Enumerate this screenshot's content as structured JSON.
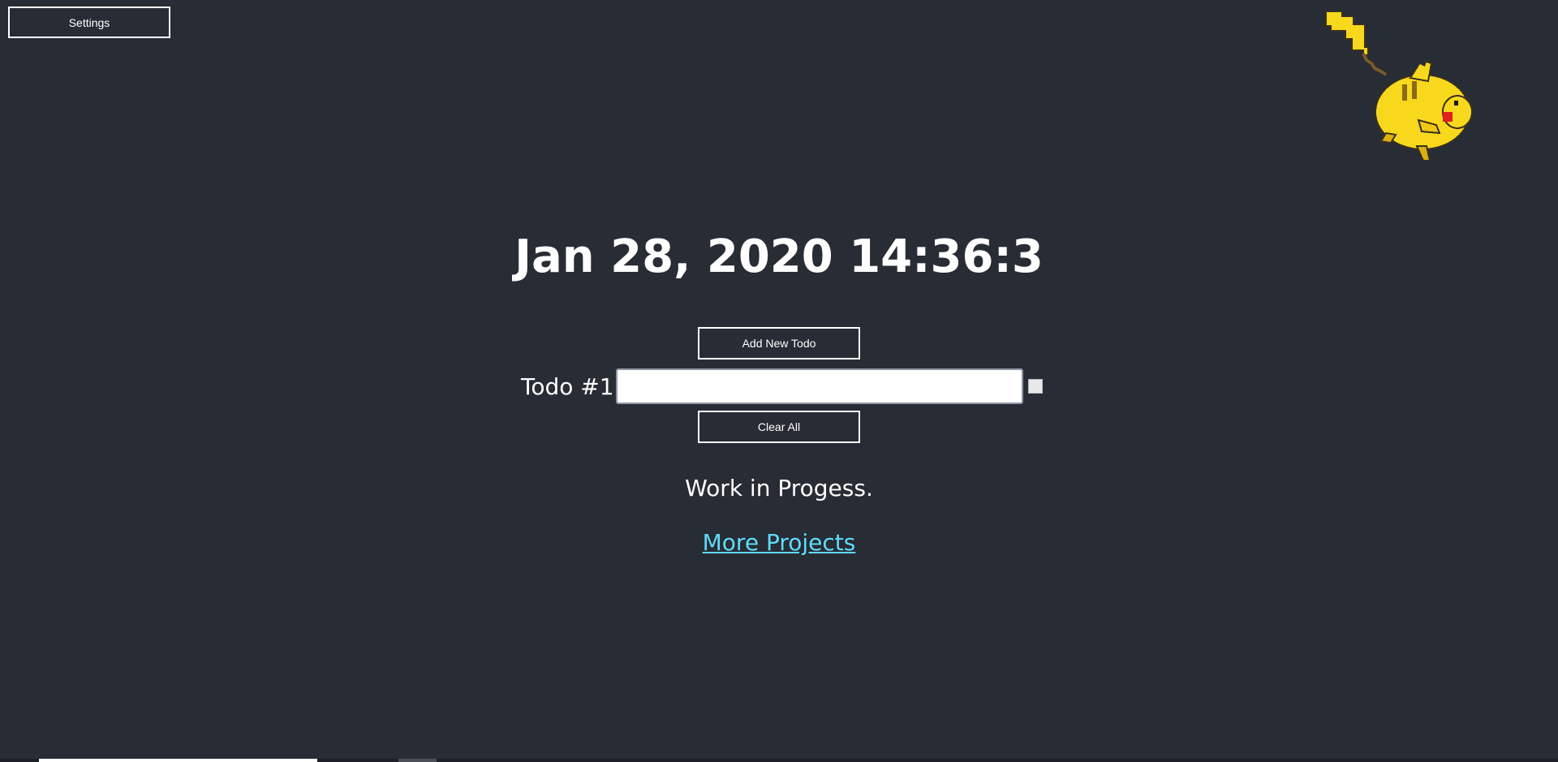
{
  "header": {
    "settings_label": "Settings"
  },
  "mascot": {
    "icon": "pikachu-icon",
    "colors": {
      "body": "#f7d81c",
      "cheek": "#e0201c",
      "outline": "#3a3020"
    }
  },
  "clock": {
    "text": "Jan 28, 2020 14:36:3"
  },
  "todos": {
    "add_label": "Add New Todo",
    "clear_label": "Clear All",
    "items": [
      {
        "label": "Todo #1",
        "value": "",
        "checked": false
      }
    ]
  },
  "status": {
    "text": "Work in Progess."
  },
  "footer": {
    "link_text": "More Projects",
    "link_color": "#61dafb"
  },
  "theme": {
    "background": "#282c34",
    "text": "#ffffff"
  }
}
